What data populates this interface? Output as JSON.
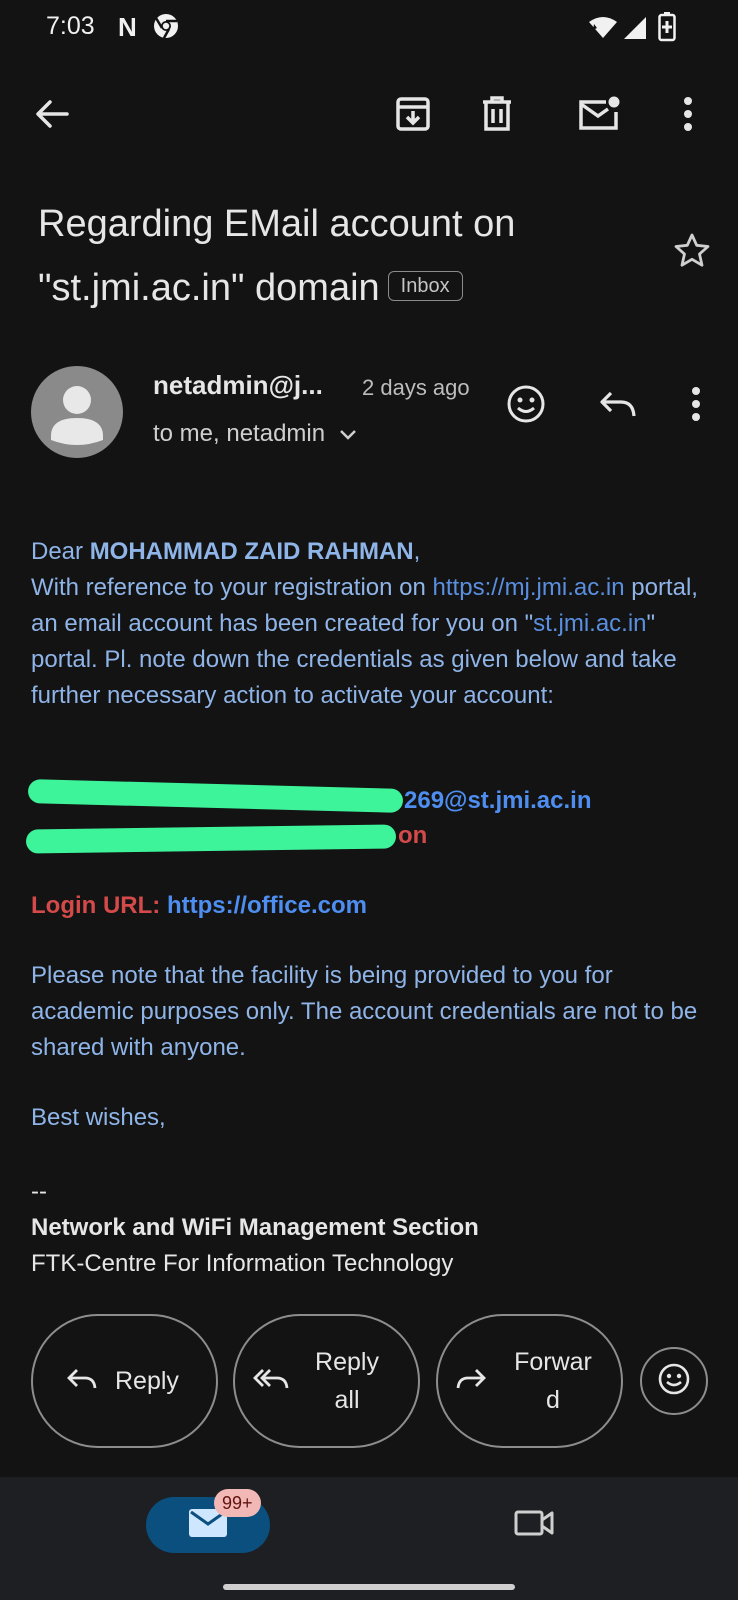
{
  "status_bar": {
    "time": "7:03",
    "netflix_glyph": "N",
    "icons": [
      "netflix-icon",
      "chrome-icon",
      "wifi-icon",
      "signal-icon",
      "battery-charging-icon"
    ]
  },
  "toolbar": {
    "icons": [
      "back-arrow-icon",
      "archive-icon",
      "trash-icon",
      "mark-unread-icon",
      "more-vert-icon"
    ]
  },
  "email": {
    "subject": "Regarding EMail account on \"st.jmi.ac.in\" domain",
    "label": "Inbox",
    "sender": "netadmin@j...",
    "time": "2 days ago",
    "recipients": "to me, netadmin",
    "body": {
      "greeting_prefix": "Dear ",
      "name": "MOHAMMAD ZAID RAHMAN",
      "greeting_suffix": ",",
      "p1_a": "With reference to your registration on ",
      "p1_link": "https://mj.jmi.ac.in",
      "p1_b": " portal, an email account has been created for you on \"",
      "p1_link2": "st.jmi.ac.in",
      "p1_c": "\" portal. Pl. note down the credentials as given below and take further necessary action to activate your account:",
      "username_visible": "269@st.jmi.ac.in",
      "password_visible": "on",
      "login_label": "Login URL: ",
      "login_url": "https://office.com",
      "p2": "Please note that the facility is being provided to you for academic purposes only. The account credentials are not to be shared with anyone.",
      "closing": "Best wishes,",
      "sig_dash": "--",
      "sig_line1": "Network and WiFi Management Section",
      "sig_line2": "FTK-Centre For Information Technology"
    }
  },
  "actions": {
    "reply": "Reply",
    "reply_all_line1": "Reply",
    "reply_all_line2": "all",
    "forward_line1": "Forwar",
    "forward_line2": "d"
  },
  "bottom_nav": {
    "mail_badge": "99+",
    "icons": [
      "mail-icon",
      "video-icon"
    ]
  },
  "colors": {
    "background": "#131313",
    "body_text": "#8fb4e8",
    "link": "#5a8fe0",
    "red": "#d44a4a",
    "redaction": "#3ef49b",
    "mail_tab": "#0a4f7e"
  }
}
